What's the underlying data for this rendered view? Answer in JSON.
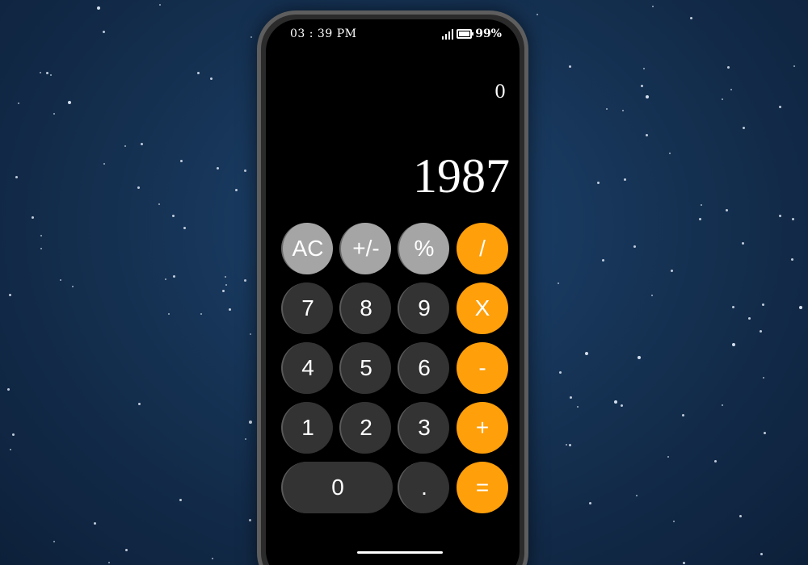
{
  "status_bar": {
    "time": "03 : 39 PM",
    "battery": "99%"
  },
  "display": {
    "previous": "0",
    "current": "1987"
  },
  "keypad": {
    "ac": "AC",
    "sign": "+/-",
    "percent": "%",
    "divide": "/",
    "seven": "7",
    "eight": "8",
    "nine": "9",
    "multiply": "X",
    "four": "4",
    "five": "5",
    "six": "6",
    "subtract": "-",
    "one": "1",
    "two": "2",
    "three": "3",
    "add": "+",
    "zero": "0",
    "decimal": ".",
    "equals": "="
  },
  "colors": {
    "operator": "#ff9f0a",
    "function": "#a5a5a5",
    "number": "#333333",
    "screen": "#000000",
    "frame": "#5e5e5e"
  },
  "icons": {
    "signal": "signal-bars-icon",
    "battery": "battery-icon"
  }
}
